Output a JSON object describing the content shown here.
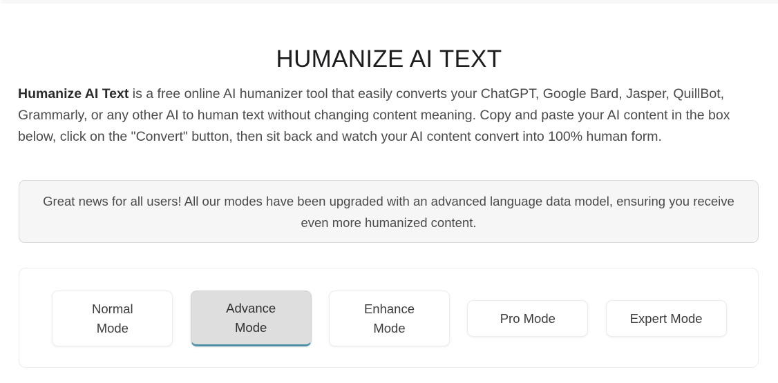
{
  "page": {
    "title": "HUMANIZE AI TEXT",
    "intro": {
      "lead_bold": "Humanize AI Text",
      "rest": " is a free online AI humanizer tool that easily converts your ChatGPT, Google Bard, Jasper, QuillBot, Grammarly, or any other AI to human text without changing content meaning. Copy and paste your AI content in the box below, click on the \"Convert\" button, then sit back and watch your AI content convert into 100% human form."
    }
  },
  "notice": {
    "message": "Great news for all users! All our modes have been upgraded with an advanced language data model, ensuring you receive even more humanized content."
  },
  "modes": {
    "selected": "Advance Mode",
    "items": [
      {
        "label": "Normal\nMode",
        "name": "normal-mode",
        "lines": 2,
        "selected": false
      },
      {
        "label": "Advance\nMode",
        "name": "advance-mode",
        "lines": 2,
        "selected": true
      },
      {
        "label": "Enhance\nMode",
        "name": "enhance-mode",
        "lines": 2,
        "selected": false
      },
      {
        "label": "Pro Mode",
        "name": "pro-mode",
        "lines": 1,
        "selected": false
      },
      {
        "label": "Expert Mode",
        "name": "expert-mode",
        "lines": 1,
        "selected": false
      }
    ]
  },
  "colors": {
    "accent": "#4f8fa6",
    "selected_bg": "#dedede",
    "notice_bg": "#f6f6f6",
    "text": "#4a4a4a",
    "title": "#1d1d1f"
  }
}
